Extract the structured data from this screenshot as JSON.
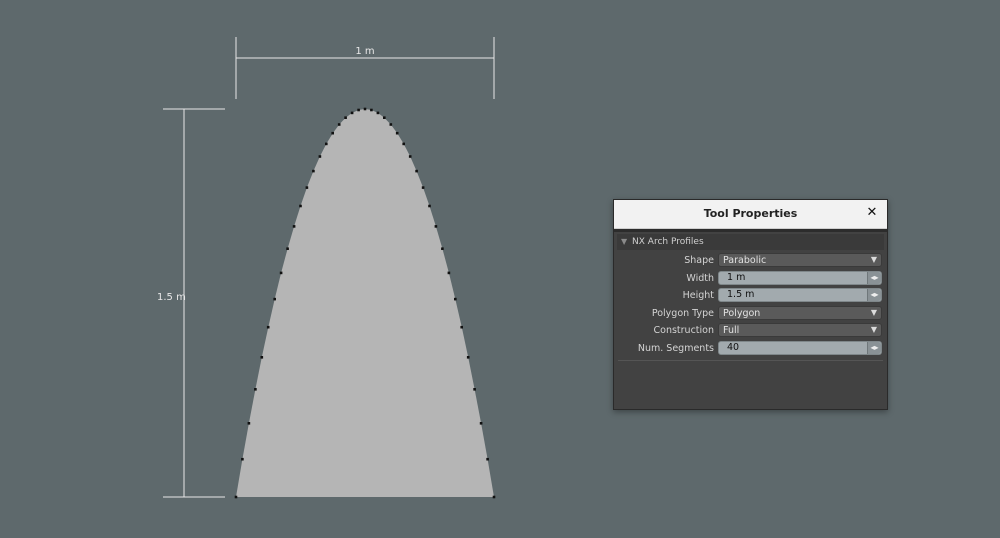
{
  "viewport": {
    "width_dimension_label": "1 m",
    "height_dimension_label": "1.5 m"
  },
  "panel": {
    "title": "Tool Properties",
    "close_icon": "✕",
    "section_title": "NX Arch Profiles",
    "fields": {
      "shape": {
        "label": "Shape",
        "value": "Parabolic"
      },
      "width": {
        "label": "Width",
        "value": "1 m"
      },
      "height": {
        "label": "Height",
        "value": "1.5 m"
      },
      "polygon_type": {
        "label": "Polygon Type",
        "value": "Polygon"
      },
      "construction": {
        "label": "Construction",
        "value": "Full"
      },
      "num_segments": {
        "label": "Num. Segments",
        "value": "40"
      }
    }
  },
  "colors": {
    "background": "#5e696c",
    "shape_fill": "#b5b5b5",
    "vertex": "#111111",
    "dimension_line": "#e8e8e8"
  }
}
